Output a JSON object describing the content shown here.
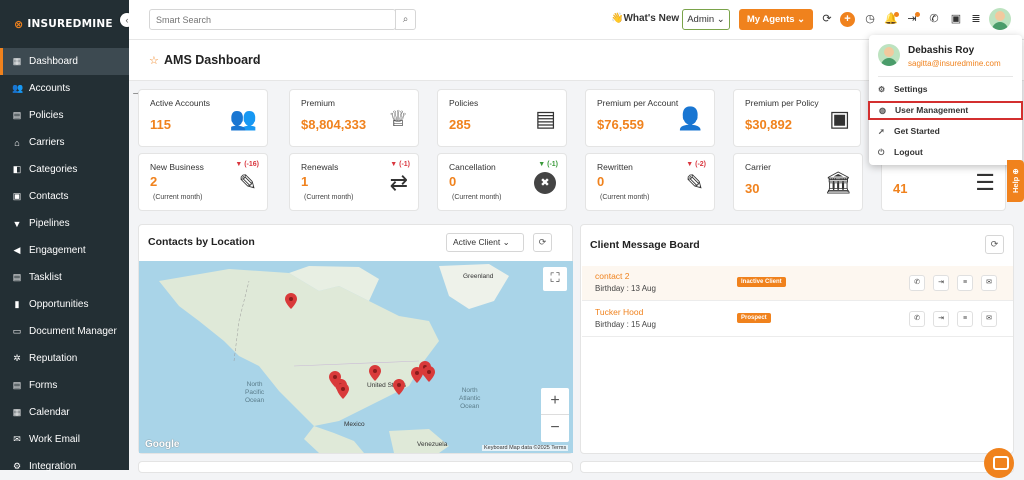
{
  "brand": {
    "name": "INSUREDMINE",
    "collapse_icon": "chevron-left-icon"
  },
  "sidebar": {
    "items": [
      {
        "label": "Dashboard",
        "icon": "grid-icon",
        "glyph": "▦",
        "active": true
      },
      {
        "label": "Accounts",
        "icon": "users-icon",
        "glyph": "👥"
      },
      {
        "label": "Policies",
        "icon": "document-icon",
        "glyph": "▤"
      },
      {
        "label": "Carriers",
        "icon": "bank-icon",
        "glyph": "⌂"
      },
      {
        "label": "Categories",
        "icon": "tag-icon",
        "glyph": "◧"
      },
      {
        "label": "Contacts",
        "icon": "contact-card-icon",
        "glyph": "▣"
      },
      {
        "label": "Pipelines",
        "icon": "funnel-icon",
        "glyph": "▼"
      },
      {
        "label": "Engagement",
        "icon": "megaphone-icon",
        "glyph": "◀"
      },
      {
        "label": "Tasklist",
        "icon": "checklist-icon",
        "glyph": "▤"
      },
      {
        "label": "Opportunities",
        "icon": "bar-chart-icon",
        "glyph": "▮"
      },
      {
        "label": "Document Manager",
        "icon": "folder-icon",
        "glyph": "▭"
      },
      {
        "label": "Reputation",
        "icon": "star-badge-icon",
        "glyph": "✲"
      },
      {
        "label": "Forms",
        "icon": "form-icon",
        "glyph": "▤"
      },
      {
        "label": "Calendar",
        "icon": "calendar-icon",
        "glyph": "▦"
      },
      {
        "label": "Work Email",
        "icon": "mail-icon",
        "glyph": "✉"
      },
      {
        "label": "Integration",
        "icon": "plug-icon",
        "glyph": "⚙"
      }
    ]
  },
  "header": {
    "search_placeholder": "Smart Search",
    "whats_new": "👋What's New",
    "admin_label": "Admin",
    "admin_chevron": "⌄",
    "my_agents_label": "My Agents ⌄"
  },
  "dashboard": {
    "title": "AMS Dashboard",
    "chevron": "⌄"
  },
  "cards_row1": [
    {
      "label": "Active Accounts",
      "value": "115",
      "icon": "accounts-icon",
      "glyph": "👥"
    },
    {
      "label": "Premium",
      "value": "$8,804,333",
      "icon": "premium-badge-icon",
      "glyph": "♕"
    },
    {
      "label": "Policies",
      "value": "285",
      "icon": "policies-icon",
      "glyph": "▤"
    },
    {
      "label": "Premium per Account",
      "value": "$76,559",
      "icon": "account-star-icon",
      "glyph": "👤"
    },
    {
      "label": "Premium per Policy",
      "value": "$30,892",
      "icon": "policy-shield-icon",
      "glyph": "▣"
    }
  ],
  "cards_row2": [
    {
      "label": "New Business",
      "value": "2",
      "sub": "(Current month)",
      "change": "▼ (-16)",
      "dir": "down",
      "icon": "new-business-icon",
      "glyph": "✎"
    },
    {
      "label": "Renewals",
      "value": "1",
      "sub": "(Current month)",
      "change": "▼ (-1)",
      "dir": "down",
      "icon": "renew-icon",
      "glyph": "⇄"
    },
    {
      "label": "Cancellation",
      "value": "0",
      "sub": "(Current month)",
      "change": "▼ (-1)",
      "dir": "up",
      "icon": "cancel-icon",
      "glyph": "✖"
    },
    {
      "label": "Rewritten",
      "value": "0",
      "sub": "(Current month)",
      "change": "▼ (-2)",
      "dir": "down",
      "icon": "rewrite-icon",
      "glyph": "✎"
    },
    {
      "label": "Carrier",
      "value": "30",
      "icon": "carrier-bank-icon",
      "glyph": "🏛"
    },
    {
      "label": "",
      "value": "41",
      "icon": "list-icon",
      "glyph": "☰"
    }
  ],
  "contacts_panel": {
    "title": "Contacts by Location",
    "filter": "Active Client ⌄",
    "map_labels": {
      "greenland": "Greenland",
      "united_states": "United States",
      "north_pacific": "North\nPacific\nOcean",
      "north_atlantic": "North\nAtlantic\nOcean",
      "mexico": "Mexico",
      "venezuela": "Venezuela"
    },
    "map_brand": "Google",
    "attribution": "Keyboard   Map data ©2025   Terms"
  },
  "message_board": {
    "title": "Client Message Board",
    "rows": [
      {
        "name": "contact 2",
        "birthday": "Birthday : 13 Aug",
        "status": "Inactive Client"
      },
      {
        "name": "Tucker Hood",
        "birthday": "Birthday : 15 Aug",
        "status": "Prospect"
      }
    ]
  },
  "user_menu": {
    "name": "Debashis Roy",
    "email": "sagitta@insuredmine.com",
    "items": [
      {
        "label": "Settings",
        "icon": "gear-icon",
        "glyph": "⚙"
      },
      {
        "label": "User Management",
        "icon": "globe-users-icon",
        "glyph": "◍",
        "highlighted": true
      },
      {
        "label": "Get Started",
        "icon": "rocket-icon",
        "glyph": "➚"
      },
      {
        "label": "Logout",
        "icon": "logout-icon",
        "glyph": "⏻"
      }
    ]
  },
  "help_tab": "Help ⊕",
  "colors": {
    "accent": "#f0821d",
    "sidebar": "#232f34",
    "highlight_border": "#d32f2f"
  }
}
